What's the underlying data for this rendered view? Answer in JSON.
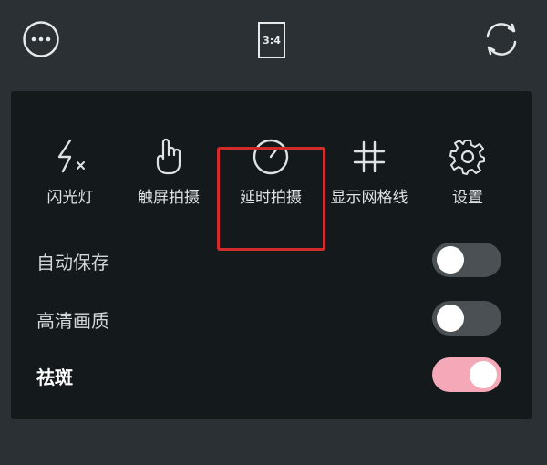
{
  "topbar": {
    "more_icon": "more-horizontal-icon",
    "aspect_ratio": "3:4",
    "flip_icon": "camera-flip-icon"
  },
  "tools": [
    {
      "label": "闪光灯",
      "icon": "flash-off-icon"
    },
    {
      "label": "触屏拍摄",
      "icon": "touch-hand-icon"
    },
    {
      "label": "延时拍摄",
      "icon": "timer-icon"
    },
    {
      "label": "显示网格线",
      "icon": "grid-icon"
    },
    {
      "label": "设置",
      "icon": "gear-icon"
    }
  ],
  "settings": [
    {
      "label": "自动保存",
      "enabled": false
    },
    {
      "label": "高清画质",
      "enabled": false
    },
    {
      "label": "祛斑",
      "enabled": true
    }
  ],
  "colors": {
    "highlight": "#d12b2b",
    "toggle_on": "#f5a8b7",
    "toggle_off": "#4a5054"
  }
}
